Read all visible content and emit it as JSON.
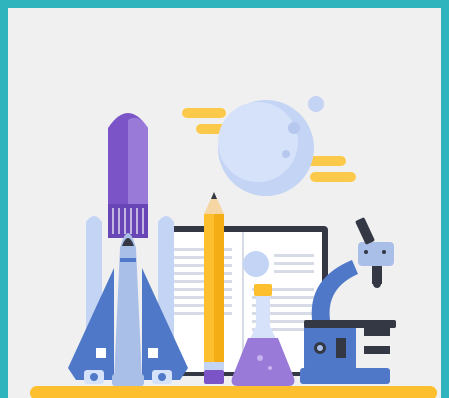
{
  "scene": {
    "subject": "science-and-education-illustration",
    "elements": [
      "space-shuttle",
      "pencil",
      "open-book",
      "flask",
      "microscope",
      "moon",
      "clouds"
    ]
  },
  "colors": {
    "border": "#2fb4bd",
    "background": "#f0f0f0",
    "purple": "#7b55c7",
    "blue": "#4f78c8",
    "light_blue": "#a9bfe8",
    "yellow": "#fdbf2d",
    "dark": "#333844",
    "white": "#ffffff"
  }
}
